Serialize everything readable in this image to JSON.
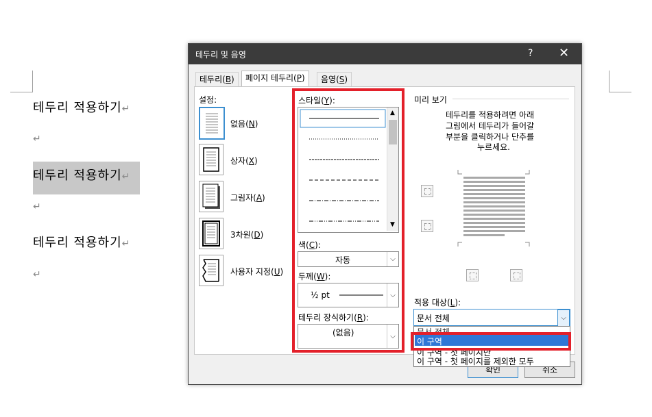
{
  "document": {
    "lines": [
      "테두리 적용하기",
      "테두리 적용하기",
      "테두리 적용하기"
    ],
    "paragraph_mark": "↵"
  },
  "dialog": {
    "title": "테두리 및 음영",
    "help": "?",
    "close": "✕",
    "tabs": [
      {
        "label": "테두리(",
        "key": "B",
        "end": ")"
      },
      {
        "label": "페이지 테두리(",
        "key": "P",
        "end": ")"
      },
      {
        "label": "음영(",
        "key": "S",
        "end": ")"
      }
    ],
    "settings": {
      "heading": "설정:",
      "items": [
        {
          "label": "없음(",
          "key": "N",
          "end": ")"
        },
        {
          "label": "상자(",
          "key": "X",
          "end": ")"
        },
        {
          "label": "그림자(",
          "key": "A",
          "end": ")"
        },
        {
          "label": "3차원(",
          "key": "D",
          "end": ")"
        },
        {
          "label": "사용자 지정(",
          "key": "U",
          "end": ")"
        }
      ]
    },
    "style": {
      "heading": "스타일(",
      "key": "Y",
      "end": "):",
      "color_label": "색(",
      "color_key": "C",
      "color_end": "):",
      "color_value": "자동",
      "width_label": "두께(",
      "width_key": "W",
      "width_end": "):",
      "width_value": "½ pt",
      "art_label": "테두리 장식하기(",
      "art_key": "R",
      "art_end": "):",
      "art_value": "(없음)"
    },
    "preview": {
      "heading": "미리 보기",
      "instruction": [
        "테두리를 적용하려면 아래",
        "그림에서 테두리가 들어갈",
        "부분을 클릭하거나 단추를",
        "누르세요."
      ]
    },
    "apply_to": {
      "label": "적용 대상(",
      "key": "L",
      "end": "):",
      "value": "문서 전체",
      "options": [
        "문서 전체",
        "이 구역",
        "이 구역 - 첫 페이지만",
        "이 구역 - 첫 페이지를 제외한 모두"
      ],
      "highlighted": "이 구역"
    },
    "buttons": {
      "ok": "확인",
      "cancel": "취소"
    }
  },
  "colors": {
    "highlight": "#e3202a",
    "selection": "#2f77d6",
    "titlebar": "#3b3b3b"
  }
}
